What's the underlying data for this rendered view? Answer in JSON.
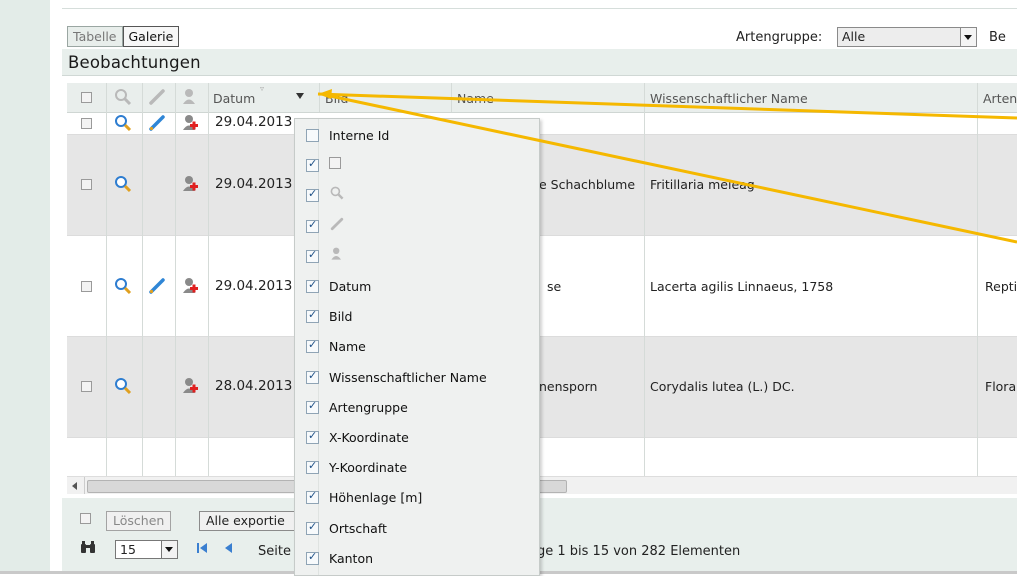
{
  "tabs": {
    "table": "Tabelle",
    "gallery": "Galerie"
  },
  "filter": {
    "label": "Artengruppe:",
    "value": "Alle",
    "truncated_next": "Be"
  },
  "title": "Beobachtungen",
  "columns": {
    "datum": "Datum",
    "bild": "Bild",
    "name": "Name",
    "scientific": "Wissenschaftlicher Name",
    "group": "Arteng"
  },
  "rows": [
    {
      "date": "29.04.2013",
      "name": "",
      "scientific": "",
      "group": ""
    },
    {
      "date": "29.04.2013",
      "name": "e Schachblume",
      "scientific": "Fritillaria meleag",
      "group": ""
    },
    {
      "date": "29.04.2013",
      "name": "se",
      "scientific": "Lacerta agilis Linnaeus, 1758",
      "group": "Reptilie"
    },
    {
      "date": "28.04.2013",
      "name": "nensporn",
      "scientific": "Corydalis lutea (L.) DC.",
      "group": "Flora"
    }
  ],
  "column_menu": {
    "items": [
      {
        "label": "Interne Id",
        "checked": false
      },
      {
        "label": "",
        "checked": true
      },
      {
        "label": "",
        "checked": true
      },
      {
        "label": "",
        "checked": true
      },
      {
        "label": "",
        "checked": true
      },
      {
        "label": "Datum",
        "checked": true
      },
      {
        "label": "Bild",
        "checked": true
      },
      {
        "label": "Name",
        "checked": true
      },
      {
        "label": "Wissenschaftlicher Name",
        "checked": true
      },
      {
        "label": "Artengruppe",
        "checked": true
      },
      {
        "label": "X-Koordinate",
        "checked": true
      },
      {
        "label": "Y-Koordinate",
        "checked": true
      },
      {
        "label": "Höhenlage [m]",
        "checked": true
      },
      {
        "label": "Ortschaft",
        "checked": true
      },
      {
        "label": "Kanton",
        "checked": true
      }
    ]
  },
  "footer": {
    "delete": "Löschen",
    "export_all": "Alle exportie",
    "page_size": "15",
    "page_label": "Seite",
    "range_text": "ge 1 bis 15 von 282 Elementen"
  },
  "colors": {
    "annotation_arrow": "#f5b800"
  }
}
